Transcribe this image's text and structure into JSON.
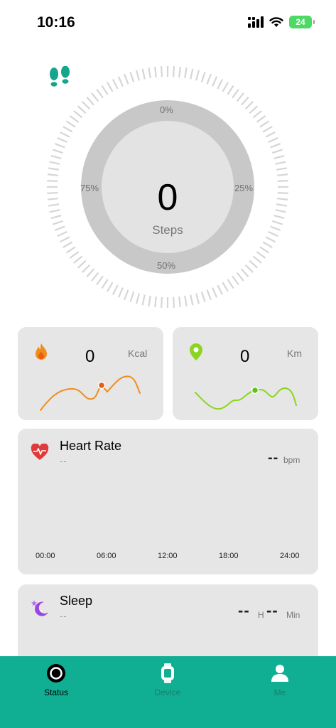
{
  "status_bar": {
    "time": "10:16",
    "battery": "24"
  },
  "steps": {
    "value": "0",
    "label": "Steps",
    "percent_top": "0%",
    "percent_right": "25%",
    "percent_bottom": "50%",
    "percent_left": "75%",
    "progress": 0
  },
  "calories": {
    "value": "0",
    "unit": "Kcal"
  },
  "distance": {
    "value": "0",
    "unit": "Km"
  },
  "heart_rate": {
    "title": "Heart Rate",
    "subtitle": "--",
    "value": "--",
    "unit": "bpm",
    "axis": [
      "00:00",
      "06:00",
      "12:00",
      "18:00",
      "24:00"
    ]
  },
  "sleep": {
    "title": "Sleep",
    "subtitle": "--",
    "hours": "--",
    "hours_unit": "H",
    "minutes": "--",
    "minutes_unit": "Min"
  },
  "tabs": [
    {
      "label": "Status",
      "icon": "ring-icon",
      "active": true
    },
    {
      "label": "Device",
      "icon": "watch-icon",
      "active": false
    },
    {
      "label": "Me",
      "icon": "person-icon",
      "active": false
    }
  ],
  "colors": {
    "accent": "#10ae92",
    "feet": "#17a58e",
    "calorie_orange": "#f08c1a",
    "distance_green": "#8ad61e",
    "heart_red": "#e03a3a",
    "sleep_purple": "#9b45e0",
    "card_bg": "#e6e6e6"
  }
}
